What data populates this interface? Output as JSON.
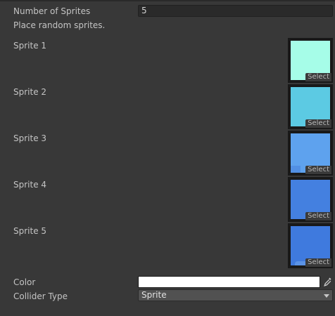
{
  "number_of_sprites": {
    "label": "Number of Sprites",
    "value": "5"
  },
  "help_text": "Place random sprites.",
  "sprites": [
    {
      "label": "Sprite 1",
      "color": "#a6fde8",
      "select_label": "Select"
    },
    {
      "label": "Sprite 2",
      "color": "#5ccae3",
      "select_label": "Select"
    },
    {
      "label": "Sprite 3",
      "color": "#5ea2ee",
      "select_label": "Select"
    },
    {
      "label": "Sprite 4",
      "color": "#4480e0",
      "select_label": "Select"
    },
    {
      "label": "Sprite 5",
      "color": "#3f7ade",
      "select_label": "Select"
    }
  ],
  "color_field": {
    "label": "Color",
    "value": "#ffffff",
    "picker_icon": "eyedropper-icon"
  },
  "collider_type": {
    "label": "Collider Type",
    "value": "Sprite"
  }
}
